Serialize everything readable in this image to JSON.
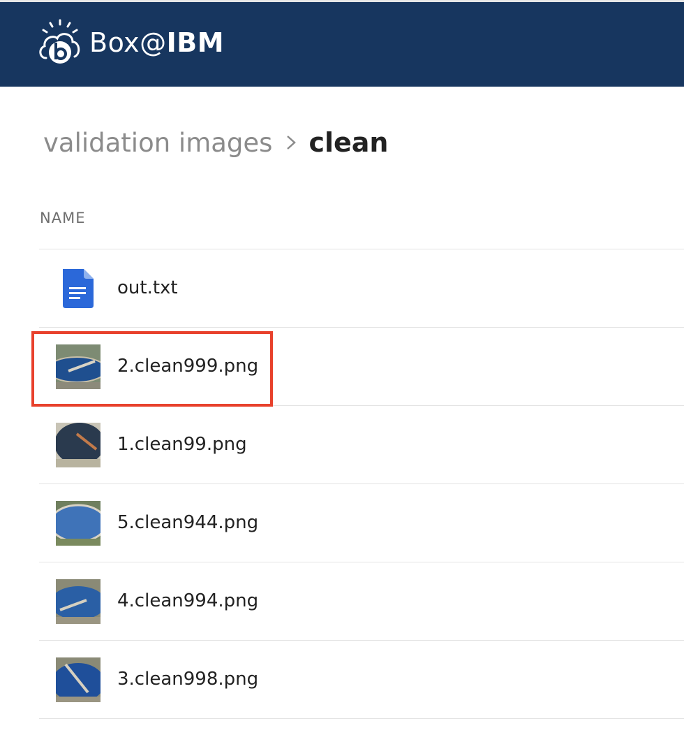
{
  "header": {
    "app_name_prefix": "Box@",
    "app_name_brand": "IBM",
    "logo_icon": "box-cloud-logo-icon",
    "background": "#17365f"
  },
  "breadcrumb": {
    "parent": "validation images",
    "separator_icon": "chevron-right-icon",
    "current": "clean"
  },
  "table": {
    "column_name": "NAME",
    "rows": [
      {
        "name": "out.txt",
        "icon": "document-icon"
      },
      {
        "name": "2.clean999.png",
        "icon": "image-thumbnail"
      },
      {
        "name": "1.clean99.png",
        "icon": "image-thumbnail"
      },
      {
        "name": "5.clean944.png",
        "icon": "image-thumbnail"
      },
      {
        "name": "4.clean994.png",
        "icon": "image-thumbnail"
      },
      {
        "name": "3.clean998.png",
        "icon": "image-thumbnail"
      }
    ]
  },
  "highlight_color": "#e8412c"
}
